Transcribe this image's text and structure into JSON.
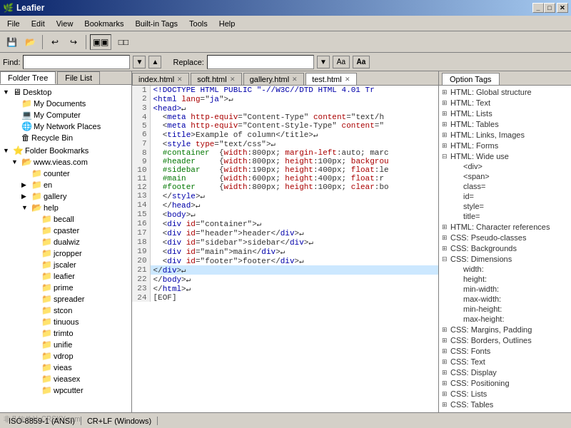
{
  "window": {
    "title": "Leafier",
    "icon": "🌿"
  },
  "menu": {
    "items": [
      "File",
      "Edit",
      "View",
      "Bookmarks",
      "Built-in Tags",
      "Tools",
      "Help"
    ]
  },
  "toolbar": {
    "buttons": [
      "💾",
      "📂",
      "↩",
      "↪",
      "□□",
      "□□"
    ]
  },
  "findbar": {
    "find_label": "Find:",
    "find_value": "",
    "replace_label": "Replace:",
    "replace_value": ""
  },
  "left_panel": {
    "tabs": [
      "Folder Tree",
      "File List"
    ],
    "active_tab": "Folder Tree",
    "tree": [
      {
        "label": "Desktop",
        "level": 0,
        "icon": "🖥",
        "expanded": true
      },
      {
        "label": "My Documents",
        "level": 1,
        "icon": "📁"
      },
      {
        "label": "My Computer",
        "level": 1,
        "icon": "💻"
      },
      {
        "label": "My Network Places",
        "level": 1,
        "icon": "🌐"
      },
      {
        "label": "Recycle Bin",
        "level": 1,
        "icon": "🗑"
      },
      {
        "label": "Folder Bookmarks",
        "level": 0,
        "icon": "⭐",
        "expanded": true
      },
      {
        "label": "www.vieas.com",
        "level": 1,
        "icon": "📁",
        "expanded": true
      },
      {
        "label": "counter",
        "level": 2,
        "icon": "📁"
      },
      {
        "label": "en",
        "level": 2,
        "icon": "📁",
        "expanded": false
      },
      {
        "label": "gallery",
        "level": 2,
        "icon": "📁",
        "expanded": false
      },
      {
        "label": "help",
        "level": 2,
        "icon": "📂",
        "expanded": true
      },
      {
        "label": "becall",
        "level": 3,
        "icon": "📁"
      },
      {
        "label": "cpaster",
        "level": 3,
        "icon": "📁"
      },
      {
        "label": "dualwiz",
        "level": 3,
        "icon": "📁"
      },
      {
        "label": "jcropper",
        "level": 3,
        "icon": "📁"
      },
      {
        "label": "jscaler",
        "level": 3,
        "icon": "📁"
      },
      {
        "label": "leafier",
        "level": 3,
        "icon": "📁"
      },
      {
        "label": "prime",
        "level": 3,
        "icon": "📁"
      },
      {
        "label": "spreader",
        "level": 3,
        "icon": "📁"
      },
      {
        "label": "stcon",
        "level": 3,
        "icon": "📁"
      },
      {
        "label": "tinuous",
        "level": 3,
        "icon": "📁"
      },
      {
        "label": "trimto",
        "level": 3,
        "icon": "📁"
      },
      {
        "label": "unifie",
        "level": 3,
        "icon": "📁"
      },
      {
        "label": "vdrop",
        "level": 3,
        "icon": "📁"
      },
      {
        "label": "vieas",
        "level": 3,
        "icon": "📁"
      },
      {
        "label": "vieasex",
        "level": 3,
        "icon": "📁"
      },
      {
        "label": "wpcutter",
        "level": 3,
        "icon": "📁"
      }
    ]
  },
  "doc_tabs": [
    {
      "label": "index.html",
      "active": false
    },
    {
      "label": "soft.html",
      "active": false
    },
    {
      "label": "gallery.html",
      "active": false
    },
    {
      "label": "test.html",
      "active": true
    }
  ],
  "code_lines": [
    {
      "num": 1,
      "code": "<!DOCTYPE HTML PUBLIC \"-//W3C//DTD HTML 4.01 Tr"
    },
    {
      "num": 2,
      "code": "<html lang=\"ja\">↵"
    },
    {
      "num": 3,
      "code": "<head>↵"
    },
    {
      "num": 4,
      "code": "  <meta http-equiv=\"Content-Type\" content=\"text/h"
    },
    {
      "num": 5,
      "code": "  <meta http-equiv=\"Content-Style-Type\" content=\""
    },
    {
      "num": 6,
      "code": "  <title>Example of column</title>↵"
    },
    {
      "num": 7,
      "code": "  <style type=\"text/css\">↵"
    },
    {
      "num": 8,
      "code": "  #container  {width:800px; margin-left:auto; marc"
    },
    {
      "num": 9,
      "code": "  #header     {width:800px; height:100px; backgrou"
    },
    {
      "num": 10,
      "code": "  #sidebar    {width:190px; height:400px; float:le"
    },
    {
      "num": 11,
      "code": "  #main       {width:600px; height:400px; float:r"
    },
    {
      "num": 12,
      "code": "  #footer     {width:800px; height:100px; clear:bo"
    },
    {
      "num": 13,
      "code": "  </style>↵"
    },
    {
      "num": 14,
      "code": "  </head>↵"
    },
    {
      "num": 15,
      "code": "  <body>↵"
    },
    {
      "num": 16,
      "code": "  <div id=\"container\">↵"
    },
    {
      "num": 17,
      "code": "  <div id=\"header\">header</div>↵"
    },
    {
      "num": 18,
      "code": "  <div id=\"sidebar\">sidebar</div>↵"
    },
    {
      "num": 19,
      "code": "  <div id=\"main\">main</div>↵"
    },
    {
      "num": 20,
      "code": "  <div id=\"footer\">footer</div>↵"
    },
    {
      "num": 21,
      "code": "</div>↵"
    },
    {
      "num": 22,
      "code": "</body>↵"
    },
    {
      "num": 23,
      "code": "</html>↵"
    },
    {
      "num": 24,
      "code": "[EOF]"
    }
  ],
  "right_panel": {
    "tab_label": "Option Tags",
    "sections": [
      {
        "label": "HTML: Global structure",
        "expanded": false,
        "items": []
      },
      {
        "label": "HTML: Text",
        "expanded": false,
        "items": []
      },
      {
        "label": "HTML: Lists",
        "expanded": false,
        "items": []
      },
      {
        "label": "HTML: Tables",
        "expanded": false,
        "items": []
      },
      {
        "label": "HTML: Links, Images",
        "expanded": false,
        "items": []
      },
      {
        "label": "HTML: Forms",
        "expanded": false,
        "items": []
      },
      {
        "label": "HTML: Wide use",
        "expanded": true,
        "items": [
          {
            "label": "<div>"
          },
          {
            "label": "<span>"
          },
          {
            "label": "class="
          },
          {
            "label": "id="
          },
          {
            "label": "style="
          },
          {
            "label": "title="
          }
        ]
      },
      {
        "label": "HTML: Character references",
        "expanded": false,
        "items": []
      },
      {
        "label": "CSS: Pseudo-classes",
        "expanded": false,
        "items": []
      },
      {
        "label": "CSS: Backgrounds",
        "expanded": false,
        "items": []
      },
      {
        "label": "CSS: Dimensions",
        "expanded": true,
        "items": [
          {
            "label": "width:"
          },
          {
            "label": "height:"
          },
          {
            "label": "min-width:"
          },
          {
            "label": "max-width:"
          },
          {
            "label": "min-height:"
          },
          {
            "label": "max-height:"
          }
        ]
      },
      {
        "label": "CSS: Margins, Padding",
        "expanded": false,
        "items": []
      },
      {
        "label": "CSS: Borders, Outlines",
        "expanded": false,
        "items": []
      },
      {
        "label": "CSS: Fonts",
        "expanded": false,
        "items": []
      },
      {
        "label": "CSS: Text",
        "expanded": false,
        "items": []
      },
      {
        "label": "CSS: Display",
        "expanded": false,
        "items": []
      },
      {
        "label": "CSS: Positioning",
        "expanded": false,
        "items": []
      },
      {
        "label": "CSS: Lists",
        "expanded": false,
        "items": []
      },
      {
        "label": "CSS: Tables",
        "expanded": false,
        "items": []
      }
    ]
  },
  "status_bar": {
    "encoding": "ISO-8859-1 (ANSI)",
    "line_ending": "CR+LF (Windows)"
  }
}
